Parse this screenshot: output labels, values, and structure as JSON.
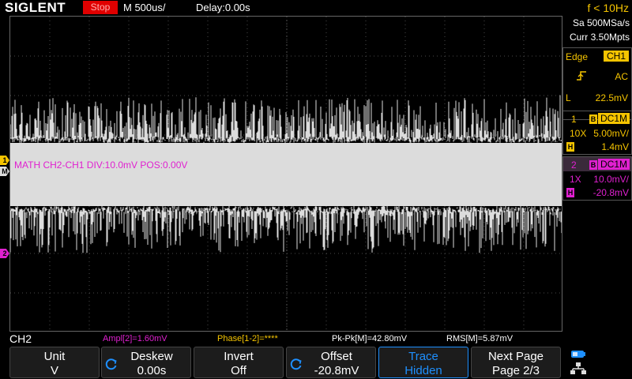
{
  "header": {
    "brand": "SIGLENT",
    "run_state": "Stop",
    "timebase": "M 500us/",
    "delay": "Delay:0.00s",
    "frequency": "f < 10Hz"
  },
  "acquisition": {
    "sample_rate": "Sa 500MSa/s",
    "memory": "Curr 3.50Mpts"
  },
  "trigger": {
    "type": "Edge",
    "source": "CH1",
    "slope": "rising-edge-icon",
    "coupling": "AC",
    "level_label": "L",
    "level": "22.5mV"
  },
  "channels": [
    {
      "num": "1",
      "bw": "B",
      "coupling": "DC1M",
      "probe": "10X",
      "vdiv": "5.00mV/",
      "hi": "H",
      "offset": "1.4mV"
    },
    {
      "num": "2",
      "bw": "B",
      "coupling": "DC1M",
      "probe": "1X",
      "vdiv": "10.0mV/",
      "hi": "H",
      "offset": "-20.8mV"
    }
  ],
  "waveform": {
    "math_label": "MATH  CH2-CH1  DIV:10.0mV  POS:0.00V",
    "markers": {
      "ch1": "1",
      "math": "M",
      "ch2": "2"
    }
  },
  "measurements": {
    "channel": "CH2",
    "ampl": "Ampl[2]=1.60mV",
    "phase": "Phase[1-2]=****",
    "pkpk": "Pk-Pk[M]=42.80mV",
    "rms": "RMS[M]=5.87mV"
  },
  "menu": [
    {
      "line1": "Unit",
      "line2": "V"
    },
    {
      "line1": "Deskew",
      "line2": "0.00s"
    },
    {
      "line1": "Invert",
      "line2": "Off"
    },
    {
      "line1": "Offset",
      "line2": "-20.8mV"
    },
    {
      "line1": "Trace",
      "line2": "Hidden"
    },
    {
      "line1": "Next Page",
      "line2": "Page 2/3"
    }
  ],
  "colors": {
    "ch1": "#f5c400",
    "ch2": "#e020d0",
    "accent": "#1e90ff",
    "trace": "#dcdcdc"
  }
}
